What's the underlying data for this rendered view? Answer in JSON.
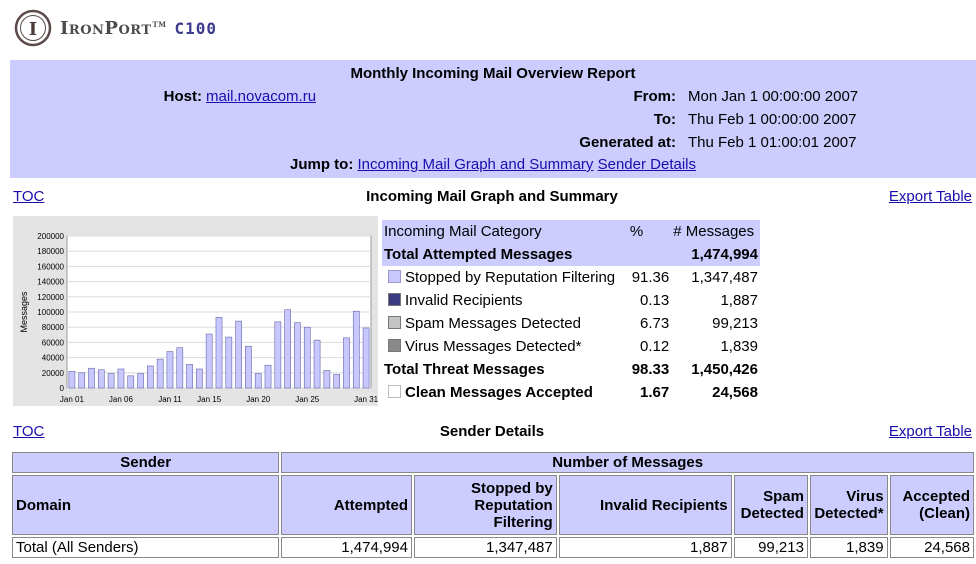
{
  "logo": {
    "brand": "IronPort",
    "tm": "TM",
    "model": "C100",
    "mark": "I"
  },
  "header": {
    "title": "Monthly Incoming Mail Overview Report",
    "host_label": "Host:",
    "host_value": "mail.novacom.ru",
    "from_label": "From:",
    "from_value": "Mon Jan 1 00:00:00 2007",
    "to_label": "To:",
    "to_value": "Thu Feb 1 00:00:00 2007",
    "generated_label": "Generated at:",
    "generated_value": "Thu Feb 1 01:00:01 2007",
    "jump_label": "Jump to:",
    "jump_links": [
      "Incoming Mail Graph and Summary",
      "Sender Details"
    ]
  },
  "section1": {
    "toc": "TOC",
    "title": "Incoming Mail Graph and Summary",
    "export": "Export Table"
  },
  "section2": {
    "toc": "TOC",
    "title": "Sender Details",
    "export": "Export Table"
  },
  "summary": {
    "headers": [
      "Incoming Mail Category",
      "%",
      "# Messages"
    ],
    "total_attempted": {
      "label": "Total Attempted Messages",
      "value": "1,474,994"
    },
    "rows": [
      {
        "label": "Stopped by Reputation Filtering",
        "pct": "91.36",
        "count": "1,347,487",
        "swatch": "#c8c8ff"
      },
      {
        "label": "Invalid Recipients",
        "pct": "0.13",
        "count": "1,887",
        "swatch": "#3a3a80"
      },
      {
        "label": "Spam Messages Detected",
        "pct": "6.73",
        "count": "99,213",
        "swatch": "#c4c4c4"
      },
      {
        "label": "Virus Messages Detected*",
        "pct": "0.12",
        "count": "1,839",
        "swatch": "#8a8a8a"
      }
    ],
    "total_threat": {
      "label": "Total Threat Messages",
      "pct": "98.33",
      "count": "1,450,426"
    },
    "clean": {
      "label": "Clean Messages Accepted",
      "pct": "1.67",
      "count": "24,568",
      "swatch": "#ffffff"
    }
  },
  "senders": {
    "group_headers": [
      "Sender",
      "Number of Messages"
    ],
    "columns": [
      "Domain",
      "Attempted",
      "Stopped by Reputation Filtering",
      "Invalid Recipients",
      "Spam Detected",
      "Virus Detected*",
      "Accepted (Clean)"
    ],
    "rows": [
      [
        "Total (All Senders)",
        "1,474,994",
        "1,347,487",
        "1,887",
        "99,213",
        "1,839",
        "24,568"
      ]
    ]
  },
  "colors": {
    "band": "#ccccff",
    "bar": "#c8c8ff",
    "bar_stroke": "#6666aa",
    "link": "#1a0dab"
  },
  "chart_data": {
    "type": "bar",
    "ylabel": "Messages",
    "ylim": [
      0,
      200000
    ],
    "yticks": [
      "0",
      "20000",
      "40000",
      "60000",
      "80000",
      "100000",
      "120000",
      "140000",
      "160000",
      "180000",
      "200000"
    ],
    "xticks": [
      "Jan 01",
      "Jan 06",
      "Jan 11",
      "Jan 15",
      "Jan 20",
      "Jan 25",
      "Jan 31"
    ],
    "xtick_days": [
      1,
      6,
      11,
      15,
      20,
      25,
      31
    ],
    "days": [
      1,
      2,
      3,
      4,
      5,
      6,
      7,
      8,
      9,
      10,
      11,
      12,
      13,
      14,
      15,
      16,
      17,
      18,
      19,
      20,
      21,
      22,
      23,
      24,
      25,
      26,
      27,
      28,
      29,
      30,
      31
    ],
    "values": [
      22000,
      20000,
      26000,
      24000,
      19000,
      25000,
      16000,
      19000,
      29000,
      38000,
      48000,
      53000,
      31000,
      25000,
      71000,
      93000,
      67000,
      88000,
      55000,
      19000,
      30000,
      87000,
      103000,
      86000,
      80000,
      63000,
      23000,
      18000,
      66000,
      101000,
      79000
    ]
  }
}
